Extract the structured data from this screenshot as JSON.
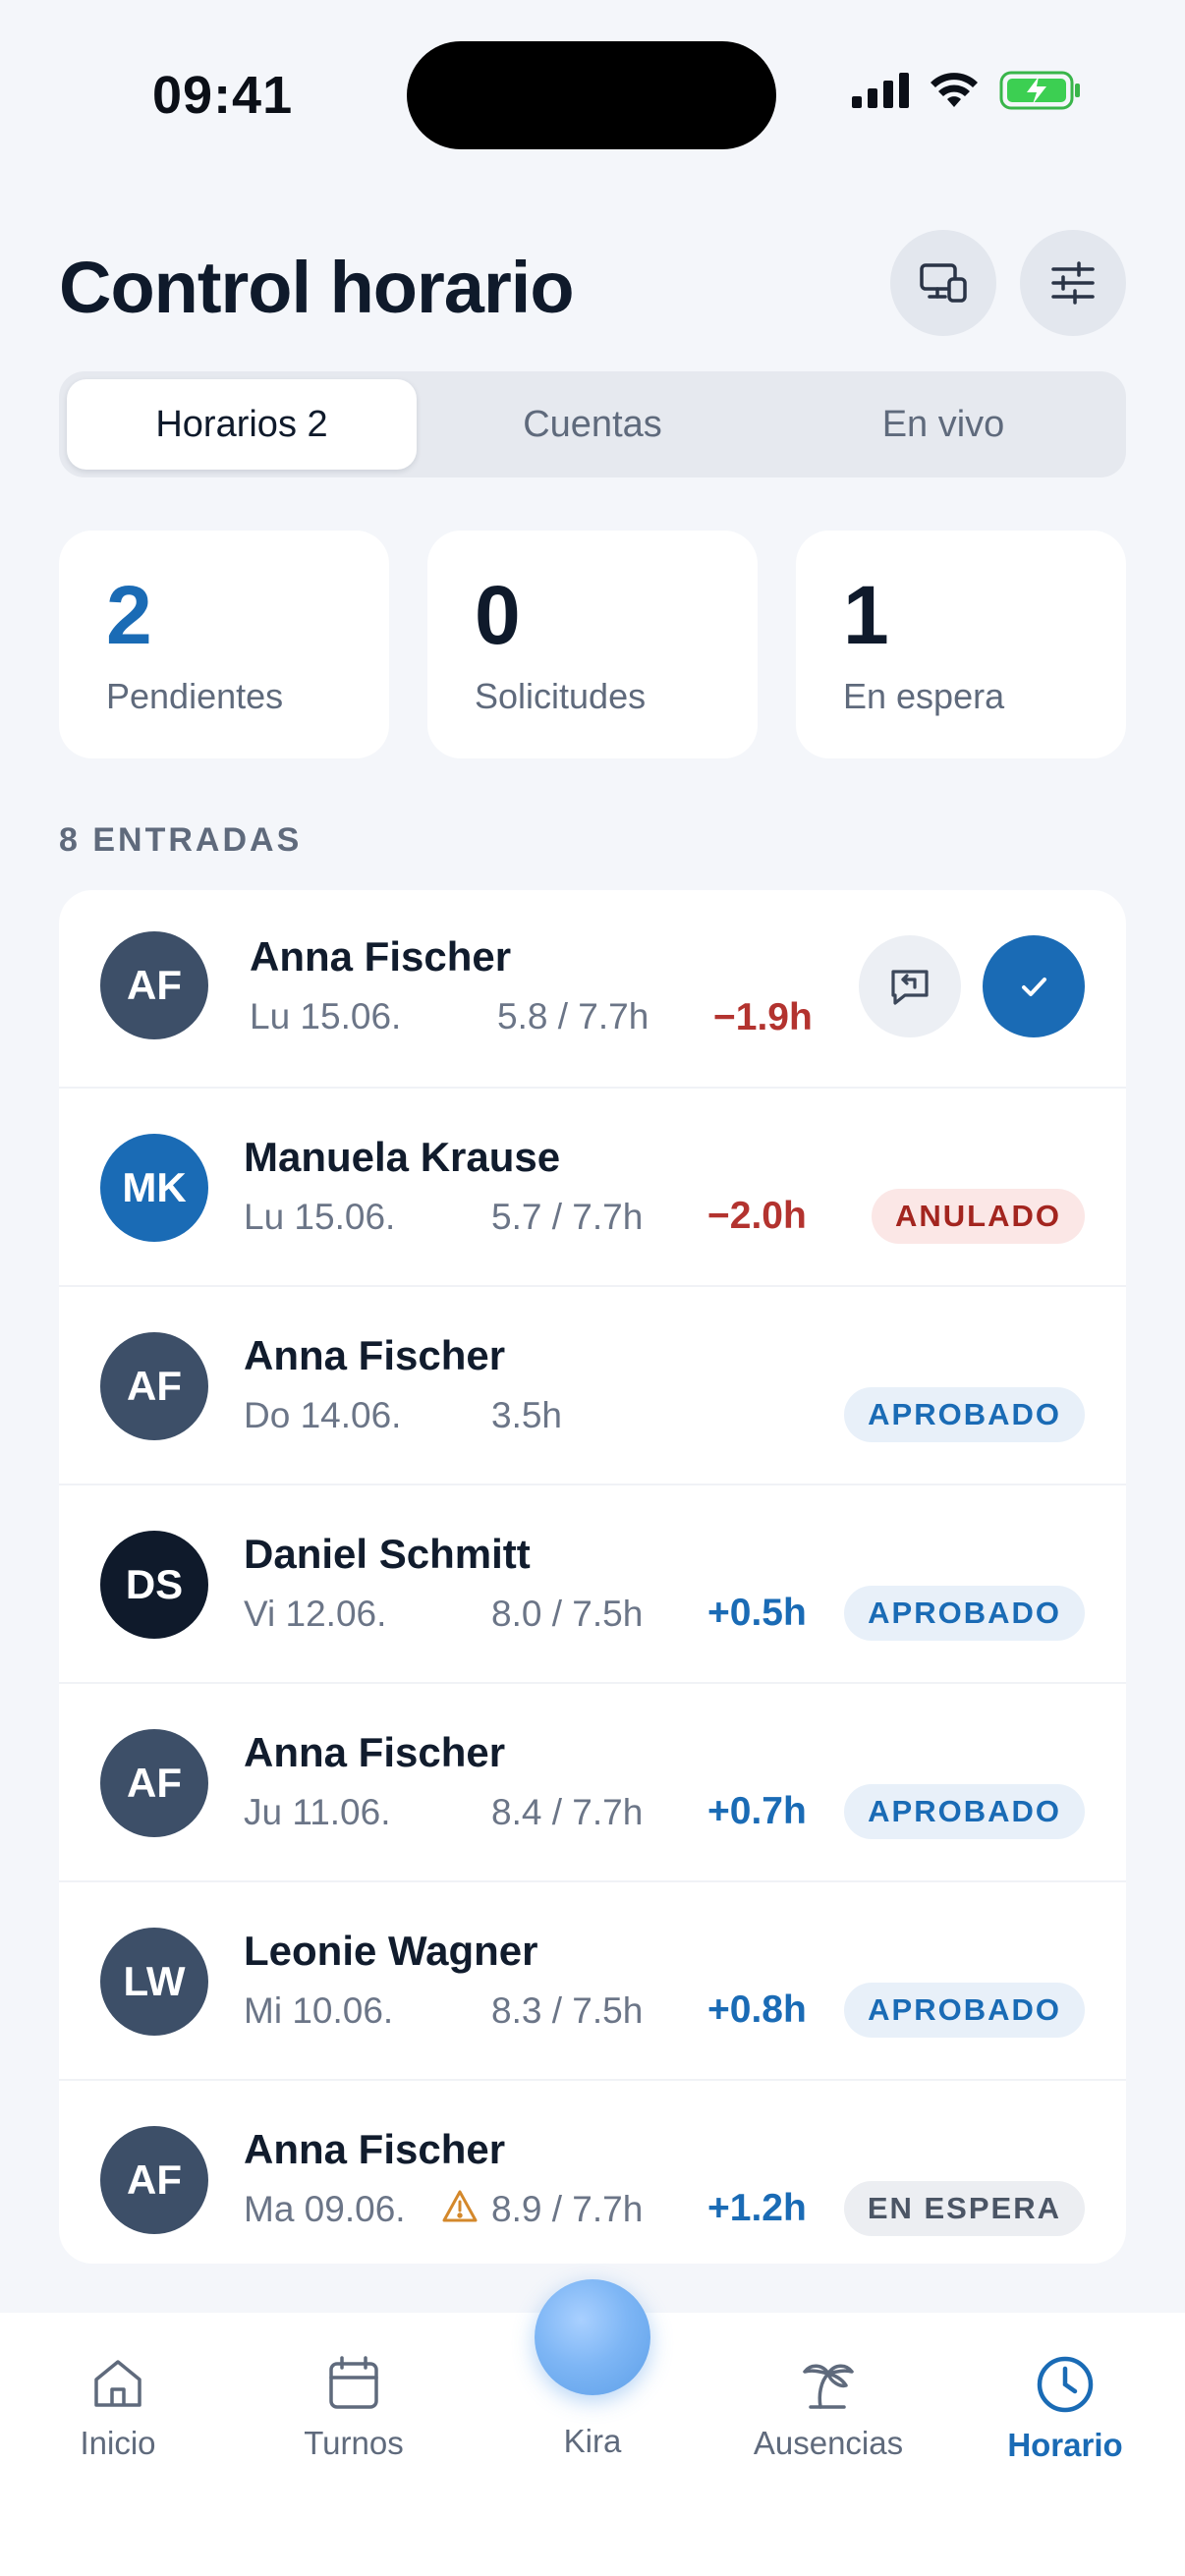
{
  "status_bar": {
    "time": "09:41"
  },
  "header": {
    "title": "Control horario"
  },
  "tabs": [
    {
      "label": "Horarios 2",
      "active": true
    },
    {
      "label": "Cuentas",
      "active": false
    },
    {
      "label": "En vivo",
      "active": false
    }
  ],
  "stats": [
    {
      "value": "2",
      "label": "Pendientes"
    },
    {
      "value": "0",
      "label": "Solicitudes"
    },
    {
      "value": "1",
      "label": "En espera"
    }
  ],
  "section_label": "8 ENTRADAS",
  "entries": [
    {
      "initials": "AF",
      "name": "Anna Fischer",
      "date": "Lu 15.06.",
      "hours": "5.8 / 7.7h",
      "delta": "−1.9h",
      "status": ""
    },
    {
      "initials": "MK",
      "name": "Manuela Krause",
      "date": "Lu 15.06.",
      "hours": "5.7 / 7.7h",
      "delta": "−2.0h",
      "status": "ANULADO"
    },
    {
      "initials": "AF",
      "name": "Anna Fischer",
      "date": "Do 14.06.",
      "hours": "3.5h",
      "delta": "",
      "status": "APROBADO"
    },
    {
      "initials": "DS",
      "name": "Daniel Schmitt",
      "date": "Vi 12.06.",
      "hours": "8.0 / 7.5h",
      "delta": "+0.5h",
      "status": "APROBADO"
    },
    {
      "initials": "AF",
      "name": "Anna Fischer",
      "date": "Ju 11.06.",
      "hours": "8.4 / 7.7h",
      "delta": "+0.7h",
      "status": "APROBADO"
    },
    {
      "initials": "LW",
      "name": "Leonie Wagner",
      "date": "Mi 10.06.",
      "hours": "8.3 / 7.5h",
      "delta": "+0.8h",
      "status": "APROBADO"
    },
    {
      "initials": "AF",
      "name": "Anna Fischer",
      "date": "Ma 09.06.",
      "hours": "8.9 / 7.7h",
      "delta": "+1.2h",
      "status": "EN ESPERA"
    }
  ],
  "nav": [
    {
      "label": "Inicio",
      "icon": "home-icon"
    },
    {
      "label": "Turnos",
      "icon": "calendar-icon"
    },
    {
      "label": "Kira",
      "icon": "assistant-orb"
    },
    {
      "label": "Ausencias",
      "icon": "palm-tree-icon"
    },
    {
      "label": "Horario",
      "icon": "clock-icon",
      "active": true
    }
  ],
  "colors": {
    "accent": "#1a6bb5",
    "negative": "#b3332f",
    "avatar_slate": "#3d4f68",
    "avatar_blue": "#1a6bb5",
    "avatar_navy": "#0f1a2b",
    "warning": "#d4882b"
  }
}
